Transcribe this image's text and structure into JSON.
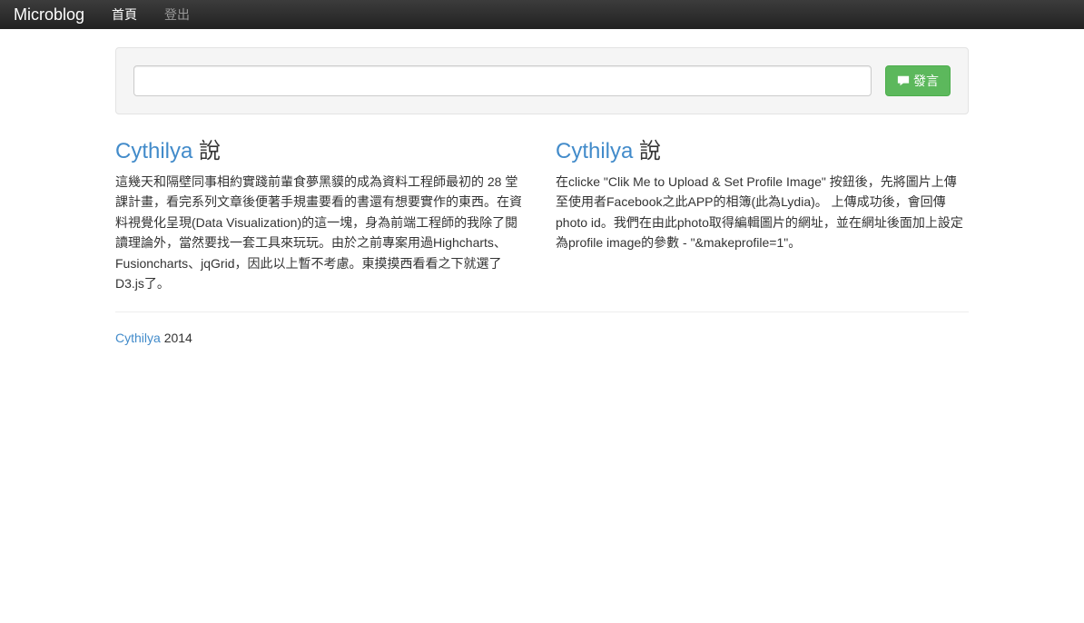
{
  "navbar": {
    "brand": "Microblog",
    "home": "首頁",
    "logout": "登出"
  },
  "composer": {
    "placeholder": "",
    "submit": "發言"
  },
  "posts": [
    {
      "author": "Cythilya",
      "verb": "說",
      "body": "這幾天和隔壁同事相約實踐前輩食夢黑貘的成為資料工程師最初的 28 堂課計畫，看完系列文章後便著手規畫要看的書還有想要實作的東西。在資料視覺化呈現(Data Visualization)的這一塊，身為前端工程師的我除了閱讀理論外，當然要找一套工具來玩玩。由於之前專案用過Highcharts、Fusioncharts、jqGrid，因此以上暫不考慮。東摸摸西看看之下就選了D3.js了。"
    },
    {
      "author": "Cythilya",
      "verb": "說",
      "body": "在clicke \"Clik Me to Upload & Set Profile Image\" 按鈕後，先將圖片上傳至使用者Facebook之此APP的相簿(此為Lydia)。 上傳成功後，會回傳photo id。我們在由此photo取得編輯圖片的網址，並在網址後面加上設定為profile image的參數 - \"&makeprofile=1\"。"
    }
  ],
  "footer": {
    "link": "Cythilya",
    "year": "2014"
  }
}
